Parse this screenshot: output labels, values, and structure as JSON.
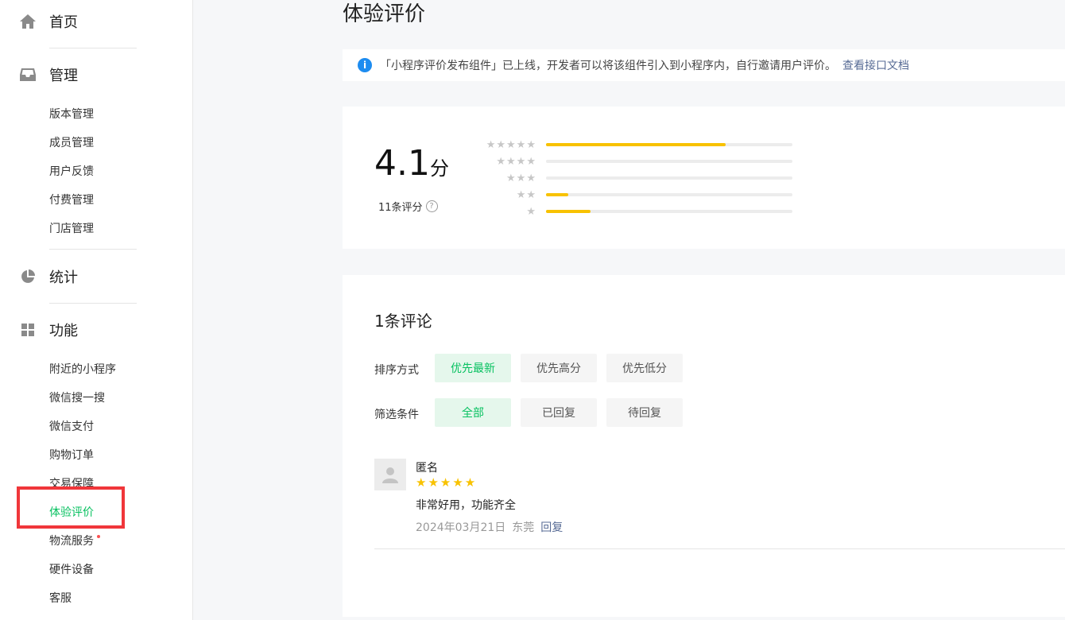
{
  "sidebar": {
    "home": "首页",
    "manage": "管理",
    "manage_items": [
      "版本管理",
      "成员管理",
      "用户反馈",
      "付费管理",
      "门店管理"
    ],
    "stats": "统计",
    "features": "功能",
    "feature_items": [
      "附近的小程序",
      "微信搜一搜",
      "微信支付",
      "购物订单",
      "交易保障",
      "体验评价",
      "物流服务",
      "硬件设备",
      "客服"
    ],
    "active_item": "体验评价"
  },
  "page": {
    "title": "体验评价",
    "notice_text": "「小程序评价发布组件」已上线，开发者可以将该组件引入到小程序内，自行邀请用户评价。",
    "notice_link": "查看接口文档"
  },
  "rating": {
    "score": "4.1",
    "unit": "分",
    "count_text": "11条评分",
    "help_glyph": "?",
    "distribution": [
      {
        "stars": "★★★★★",
        "fraction": 0.73
      },
      {
        "stars": "★★★★",
        "fraction": 0.0
      },
      {
        "stars": "★★★",
        "fraction": 0.0
      },
      {
        "stars": "★★",
        "fraction": 0.09
      },
      {
        "stars": "★",
        "fraction": 0.18
      }
    ]
  },
  "comments": {
    "title": "1条评论",
    "sort_label": "排序方式",
    "sort_options": [
      "优先最新",
      "优先高分",
      "优先低分"
    ],
    "filter_label": "筛选条件",
    "filter_options": [
      "全部",
      "已回复",
      "待回复"
    ],
    "items": [
      {
        "name": "匿名",
        "stars": "★★★★★",
        "text": "非常好用，功能齐全",
        "date": "2024年03月21日",
        "location": "东莞",
        "reply_label": "回复"
      }
    ]
  },
  "colors": {
    "accent": "#07c160",
    "star": "#f8c200",
    "link": "#576b95",
    "highlight": "#f0363a"
  }
}
